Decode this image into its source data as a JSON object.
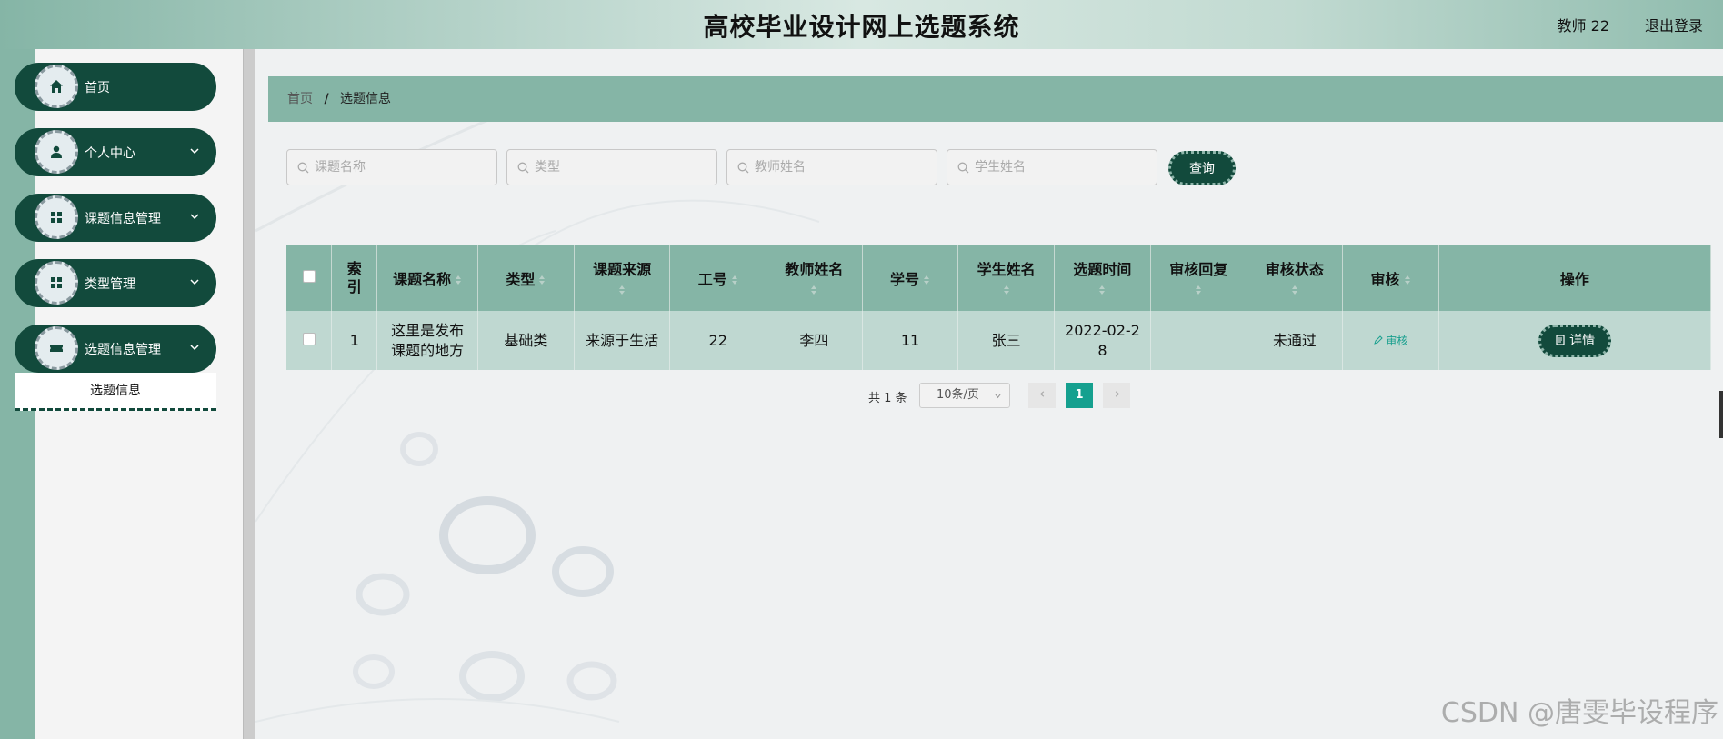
{
  "header": {
    "title": "高校毕业设计网上选题系统",
    "user": "教师 22",
    "logout": "退出登录"
  },
  "sidebar": {
    "items": [
      {
        "label": "首页",
        "icon": "home-icon"
      },
      {
        "label": "个人中心",
        "icon": "user-icon"
      },
      {
        "label": "课题信息管理",
        "icon": "grid-icon"
      },
      {
        "label": "类型管理",
        "icon": "grid-icon"
      },
      {
        "label": "选题信息管理",
        "icon": "ticket-icon"
      }
    ],
    "submenu": "选题信息"
  },
  "breadcrumb": {
    "home": "首页",
    "separator": "/",
    "current": "选题信息"
  },
  "search": {
    "topic_placeholder": "课题名称",
    "type_placeholder": "类型",
    "teacher_placeholder": "教师姓名",
    "student_placeholder": "学生姓名",
    "query_label": "查询"
  },
  "table": {
    "columns": [
      "索引",
      "课题名称",
      "类型",
      "课题来源",
      "工号",
      "教师姓名",
      "学号",
      "学生姓名",
      "选题时间",
      "审核回复",
      "审核状态",
      "审核",
      "操作"
    ],
    "rows": [
      {
        "index": "1",
        "topic": "这里是发布课题的地方",
        "type": "基础类",
        "source": "来源于生活",
        "job_no": "22",
        "teacher": "李四",
        "student_no": "11",
        "student": "张三",
        "time": "2022-02-28",
        "reply": "",
        "status": "未通过",
        "audit_label": "审核",
        "detail_label": "详情"
      }
    ]
  },
  "pagination": {
    "total": "共 1 条",
    "page_size": "10条/页",
    "current_page": "1"
  },
  "watermark": "CSDN @唐雯毕设程序",
  "colors": {
    "dark_green": "#124a3c",
    "mid_green": "#85b5a6",
    "row_bg": "#bfd8d1",
    "page_active": "#15a08f"
  }
}
